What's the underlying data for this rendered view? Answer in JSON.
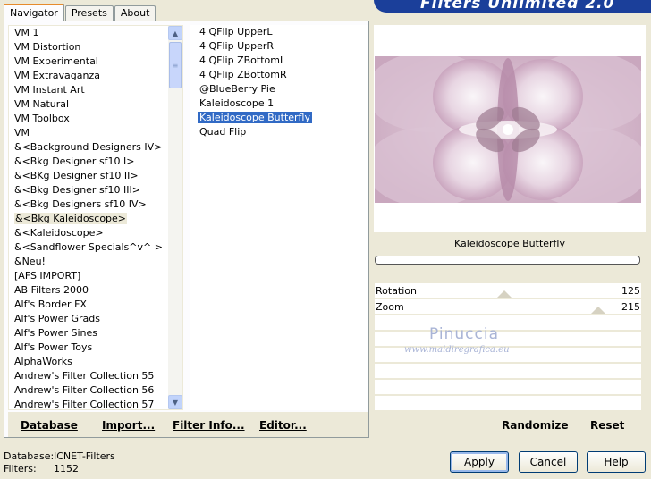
{
  "header": {
    "title": "Filters Unlimited 2.0"
  },
  "tabs": [
    {
      "label": "Navigator"
    },
    {
      "label": "Presets"
    },
    {
      "label": "About"
    }
  ],
  "categories": [
    "VM 1",
    "VM Distortion",
    "VM Experimental",
    "VM Extravaganza",
    "VM Instant Art",
    "VM Natural",
    "VM Toolbox",
    "VM",
    "&<Background Designers IV>",
    "&<Bkg Designer sf10 I>",
    "&<BKg Designer sf10 II>",
    "&<Bkg Designer sf10 III>",
    "&<Bkg Designers sf10 IV>",
    "&<Bkg Kaleidoscope>",
    "&<Kaleidoscope>",
    "&<Sandflower Specials^v^ >",
    "&Neu!",
    "[AFS IMPORT]",
    "AB Filters 2000",
    "Alf's Border FX",
    "Alf's Power Grads",
    "Alf's Power Sines",
    "Alf's Power Toys",
    "AlphaWorks",
    "Andrew's Filter Collection 55",
    "Andrew's Filter Collection 56",
    "Andrew's Filter Collection 57"
  ],
  "filters": [
    "4 QFlip UpperL",
    "4 QFlip UpperR",
    "4 QFlip ZBottomL",
    "4 QFlip ZBottomR",
    "@BlueBerry Pie",
    "Kaleidoscope 1",
    "Kaleidoscope Butterfly",
    "Quad Flip"
  ],
  "left_toolbar": {
    "database": "Database",
    "import": "Import...",
    "filter_info": "Filter Info...",
    "editor": "Editor..."
  },
  "preview": {
    "filter_name": "Kaleidoscope Butterfly"
  },
  "params": [
    {
      "label": "Rotation",
      "value": "125"
    },
    {
      "label": "Zoom",
      "value": "215"
    }
  ],
  "watermark": {
    "line1": "Pinuccia",
    "line2": "www.maidiregrafica.eu"
  },
  "right_toolbar": {
    "randomize": "Randomize",
    "reset": "Reset"
  },
  "footer": {
    "database_label": "Database:",
    "database_value": "ICNET-Filters",
    "filters_label": "Filters:",
    "filters_value": "1152"
  },
  "buttons": {
    "apply": "Apply",
    "cancel": "Cancel",
    "help": "Help"
  }
}
